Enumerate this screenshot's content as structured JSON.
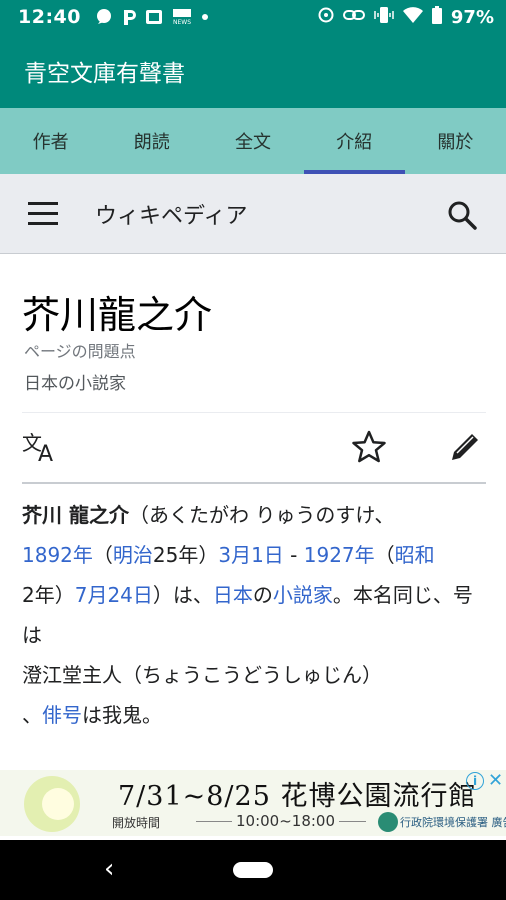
{
  "status_bar": {
    "time": "12:40",
    "battery": "97%",
    "icons": [
      "chat-icon",
      "p-icon",
      "tv-icon",
      "news-icon",
      "dot-icon",
      "sync-icon",
      "link-icon",
      "vibrate-icon",
      "wifi-icon",
      "battery-icon"
    ]
  },
  "app": {
    "title": "青空文庫有聲書"
  },
  "tabs": [
    {
      "label": "作者",
      "active": false
    },
    {
      "label": "朗読",
      "active": false
    },
    {
      "label": "全文",
      "active": false
    },
    {
      "label": "介紹",
      "active": true
    },
    {
      "label": "關於",
      "active": false
    }
  ],
  "wiki": {
    "logo": "ウィキペディア",
    "title": "芥川龍之介",
    "issues_link": "ページの問題点",
    "description": "日本の小説家"
  },
  "article": {
    "name": "芥川 龍之介",
    "reading": "（あくたがわ りゅうのすけ、",
    "birth_year": "1892年",
    "open_paren": "（",
    "era_1": "明治",
    "era_1_year": "25年）",
    "birth_date": "3月1日",
    "dash": " - ",
    "death_year": "1927年",
    "open_paren_2": "（",
    "era_2": "昭和",
    "era_2_year": "2年）",
    "death_date": "7月24日",
    "wa": "）は、",
    "japan": "日本",
    "no": "の",
    "novelist": "小説家",
    "rest_1": "。本名同じ、号は",
    "rest_2": "澄江堂主人（ちょうこうどうしゅじん）",
    "comma": "、",
    "haigo": "俳号",
    "rest_3": "は我鬼。"
  },
  "ad": {
    "headline": "7/31~8/25  花博公園流行館",
    "hours_label": "開放時間",
    "hours": "10:00~18:00",
    "sponsor": "行政院環境保護署 廣告",
    "info": "i",
    "close": "✕"
  },
  "nav": {
    "back": "‹"
  }
}
